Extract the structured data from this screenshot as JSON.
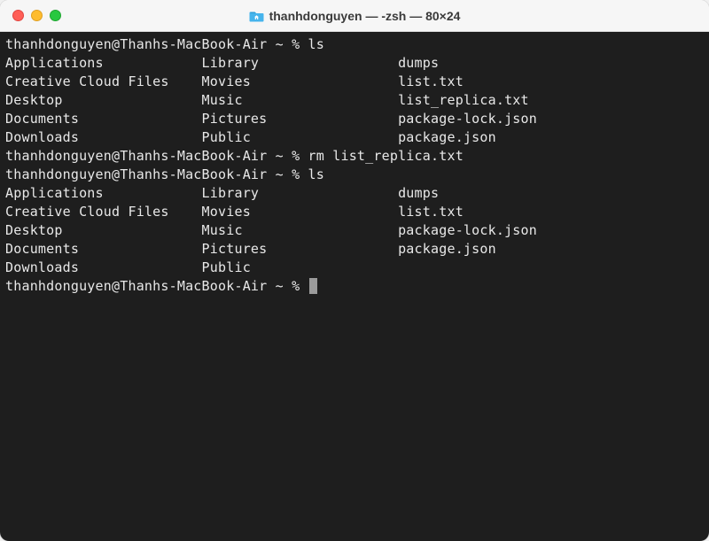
{
  "titlebar": {
    "icon": "home-folder-icon",
    "title": "thanhdonguyen — -zsh — 80×24"
  },
  "traffic_lights": {
    "close": "close",
    "minimize": "minimize",
    "zoom": "zoom"
  },
  "prompt": "thanhdonguyen@Thanhs-MacBook-Air ~ %",
  "commands": {
    "ls1": "ls",
    "rm": "rm list_replica.txt",
    "ls2": "ls"
  },
  "listing1": {
    "col1": [
      "Applications",
      "Creative Cloud Files",
      "Desktop",
      "Documents",
      "Downloads"
    ],
    "col2": [
      "Library",
      "Movies",
      "Music",
      "Pictures",
      "Public"
    ],
    "col3": [
      "dumps",
      "list.txt",
      "list_replica.txt",
      "package-lock.json",
      "package.json"
    ]
  },
  "listing2": {
    "col1": [
      "Applications",
      "Creative Cloud Files",
      "Desktop",
      "Documents",
      "Downloads"
    ],
    "col2": [
      "Library",
      "Movies",
      "Music",
      "Pictures",
      "Public"
    ],
    "col3": [
      "dumps",
      "list.txt",
      "package-lock.json",
      "package.json",
      ""
    ]
  },
  "colwidths": {
    "c1": 24,
    "c2": 24
  }
}
